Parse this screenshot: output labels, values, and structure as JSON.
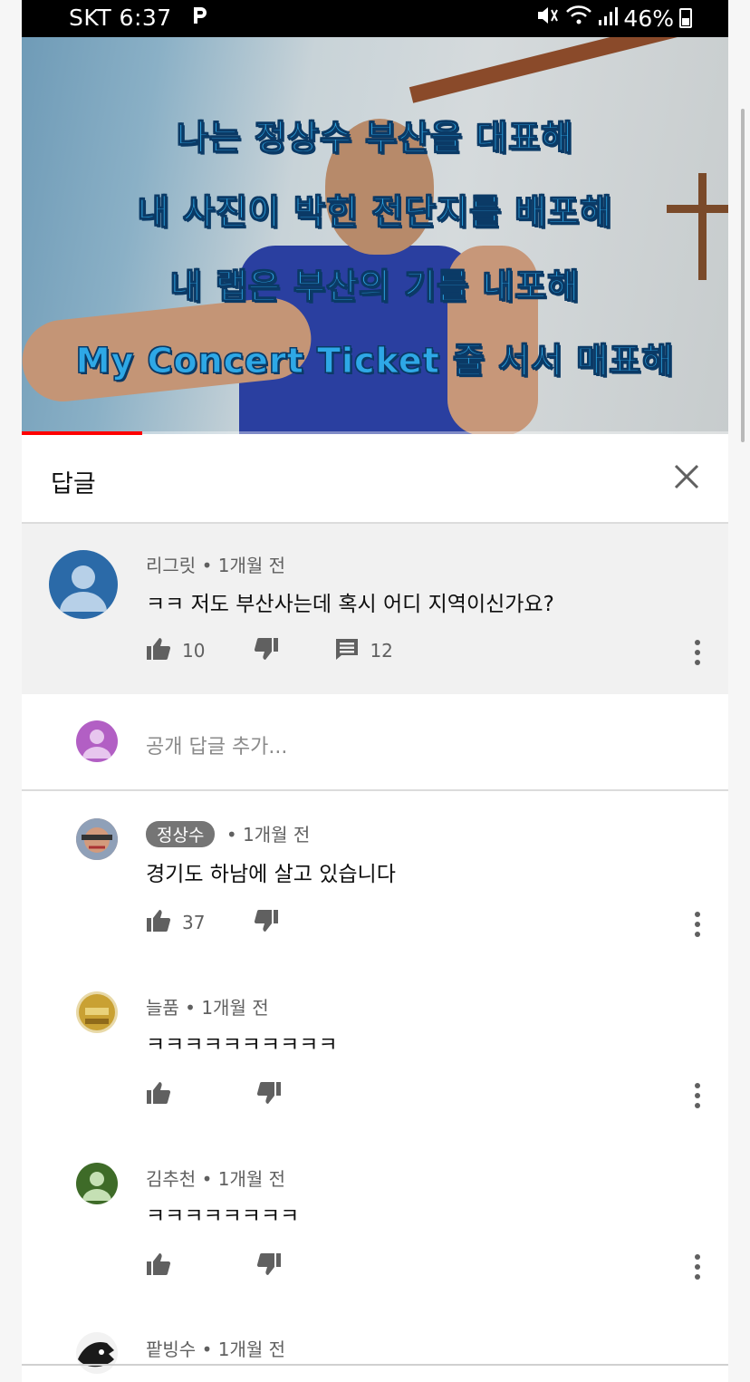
{
  "status_bar": {
    "carrier": "SKT",
    "time": "6:37",
    "battery": "46%"
  },
  "video": {
    "lyrics": [
      "나는 정상수 부산을 대표해",
      "내 사진이 박힌 전단지를 배포해",
      "내 랩은 부산의 기를 내포해",
      "My Concert Ticket 줄 서서 매표해"
    ],
    "progress": 0.17
  },
  "header": {
    "title": "답글"
  },
  "parent_comment": {
    "author": "리그릿",
    "time": "1개월 전",
    "text": "ㅋㅋ 저도 부산사는데 혹시 어디 지역이신가요?",
    "likes": "10",
    "replies": "12"
  },
  "add_reply": {
    "placeholder": "공개 답글 추가..."
  },
  "replies": [
    {
      "author": "정상수",
      "time": "1개월 전",
      "text": "경기도 하남에 살고 있습니다",
      "likes": "37"
    },
    {
      "author": "늘품",
      "time": "1개월 전",
      "text": "ㅋㅋㅋㅋㅋㅋㅋㅋㅋㅋ",
      "likes": ""
    },
    {
      "author": "김추천",
      "time": "1개월 전",
      "text": "ㅋㅋㅋㅋㅋㅋㅋㅋ",
      "likes": ""
    },
    {
      "author": "팥빙수",
      "time": "1개월 전"
    }
  ],
  "separator": "•",
  "colors": {
    "accent_red": "#ff0000",
    "parent_bg": "#f1f1f1",
    "lyric_blue": "#2ea8e6"
  },
  "icons": [
    "like-icon",
    "dislike-icon",
    "reply-count-icon",
    "more-vert-icon",
    "close-icon",
    "mute-icon",
    "wifi-icon",
    "signal-icon",
    "battery-icon"
  ]
}
